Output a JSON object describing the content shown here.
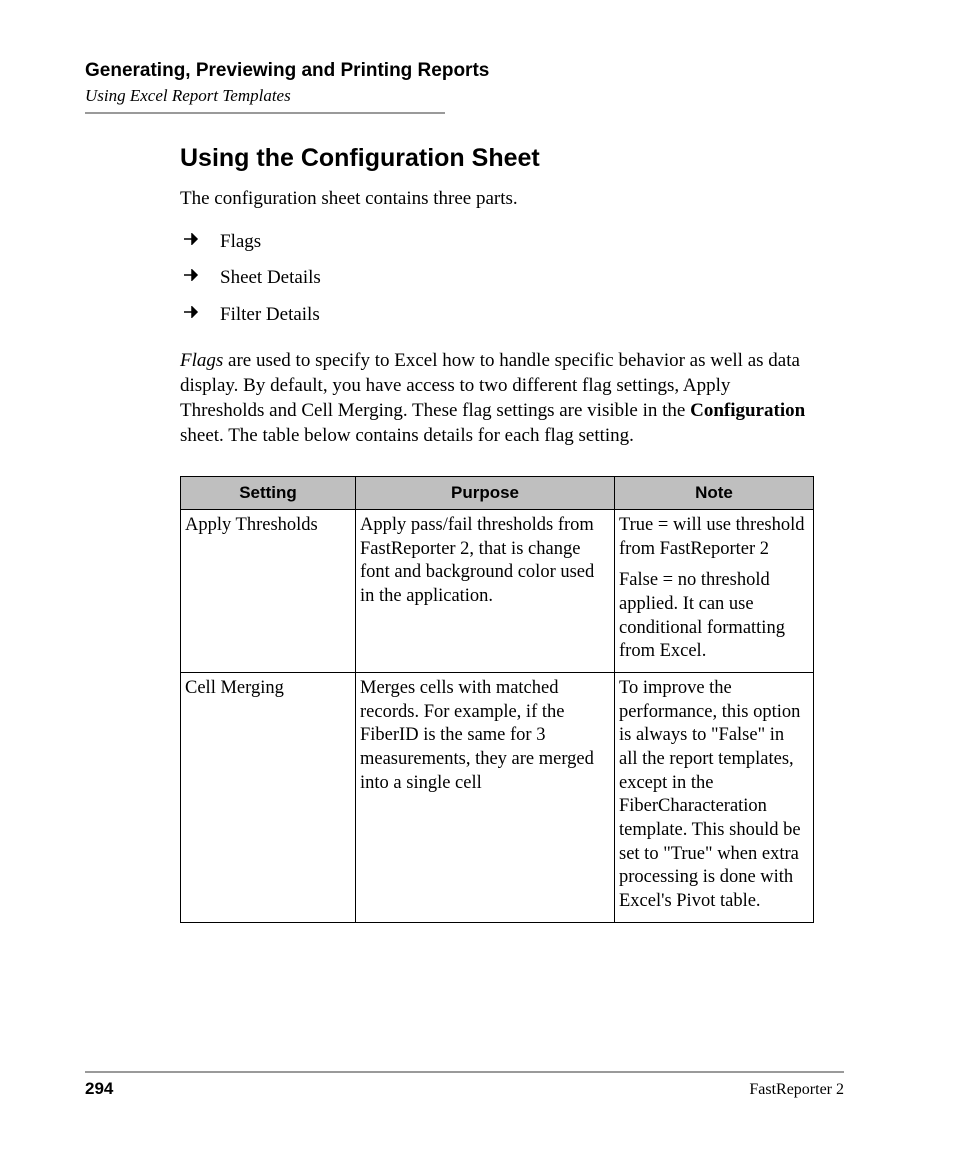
{
  "header": {
    "chapter": "Generating, Previewing and Printing Reports",
    "section": "Using Excel Report Templates"
  },
  "title": "Using the Configuration Sheet",
  "intro": "The configuration sheet contains three parts.",
  "bullets": [
    "Flags",
    "Sheet Details",
    "Filter Details"
  ],
  "para_pre_italic": "Flags",
  "para_mid": " are used to specify to Excel how to handle specific behavior as well as data display. By default, you have access to two different flag settings, Apply Thresholds and Cell Merging. These flag settings are visible in the ",
  "para_bold": "Configuration",
  "para_post": " sheet. The table below contains details for each flag setting.",
  "table": {
    "headers": [
      "Setting",
      "Purpose",
      "Note"
    ],
    "rows": [
      {
        "setting": "Apply Thresholds",
        "purpose": "Apply pass/fail thresholds from FastReporter 2, that is change font and background color used in the application.",
        "note": [
          "True = will use threshold from FastReporter 2",
          "False = no threshold applied. It can use conditional formatting from Excel."
        ]
      },
      {
        "setting": "Cell Merging",
        "purpose": "Merges cells with matched records. For example, if the FiberID is the same for 3 measurements, they are merged into a single cell",
        "note": [
          "To improve the performance, this option is always to \"False\" in all the report templates, except in the FiberCharacteration template. This should be set to \"True\" when extra processing is done with Excel's Pivot table."
        ]
      }
    ]
  },
  "footer": {
    "page": "294",
    "product": "FastReporter 2"
  }
}
